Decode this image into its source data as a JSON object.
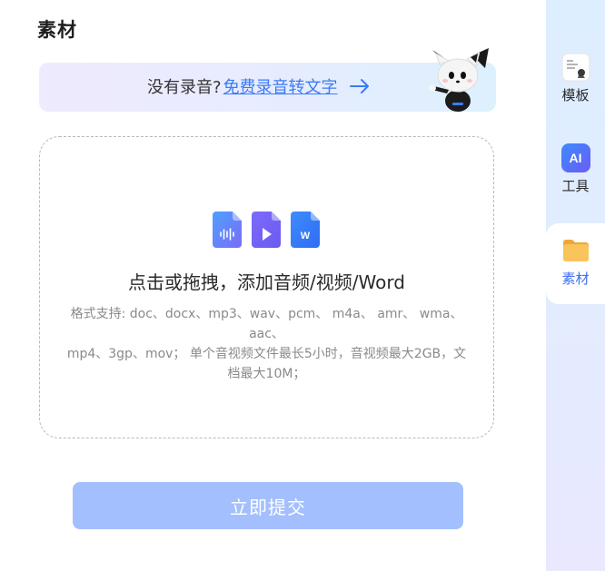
{
  "page": {
    "title": "素材"
  },
  "record_banner": {
    "prompt": "没有录音?",
    "link": "免费录音转文字",
    "arrow_icon": "arrow-right-icon"
  },
  "dropzone": {
    "title": "点击或拖拽，添加音频/视频/Word",
    "desc_lines": [
      "格式支持: doc、docx、mp3、wav、pcm、 m4a、 amr、 wma、",
      "aac、",
      "mp4、3gp、mov； 单个音视频文件最长5小时，音视频最大2GB，文",
      "档最大10M；"
    ],
    "icons": [
      "audio-file-icon",
      "video-file-icon",
      "word-file-icon"
    ],
    "icon_letter_word": "W"
  },
  "submit": {
    "label": "立即提交"
  },
  "sidebar": {
    "items": [
      {
        "label": "模板",
        "icon": "template-icon",
        "active": false
      },
      {
        "label": "工具",
        "icon": "ai-tool-icon",
        "icon_text": "AI",
        "active": false
      },
      {
        "label": "素材",
        "icon": "folder-icon",
        "active": true
      }
    ]
  },
  "colors": {
    "accent": "#3b6ef6",
    "link": "#3b7bf6",
    "submit_bg": "#a3bffe",
    "sidebar_bg": "#ddeefe"
  }
}
